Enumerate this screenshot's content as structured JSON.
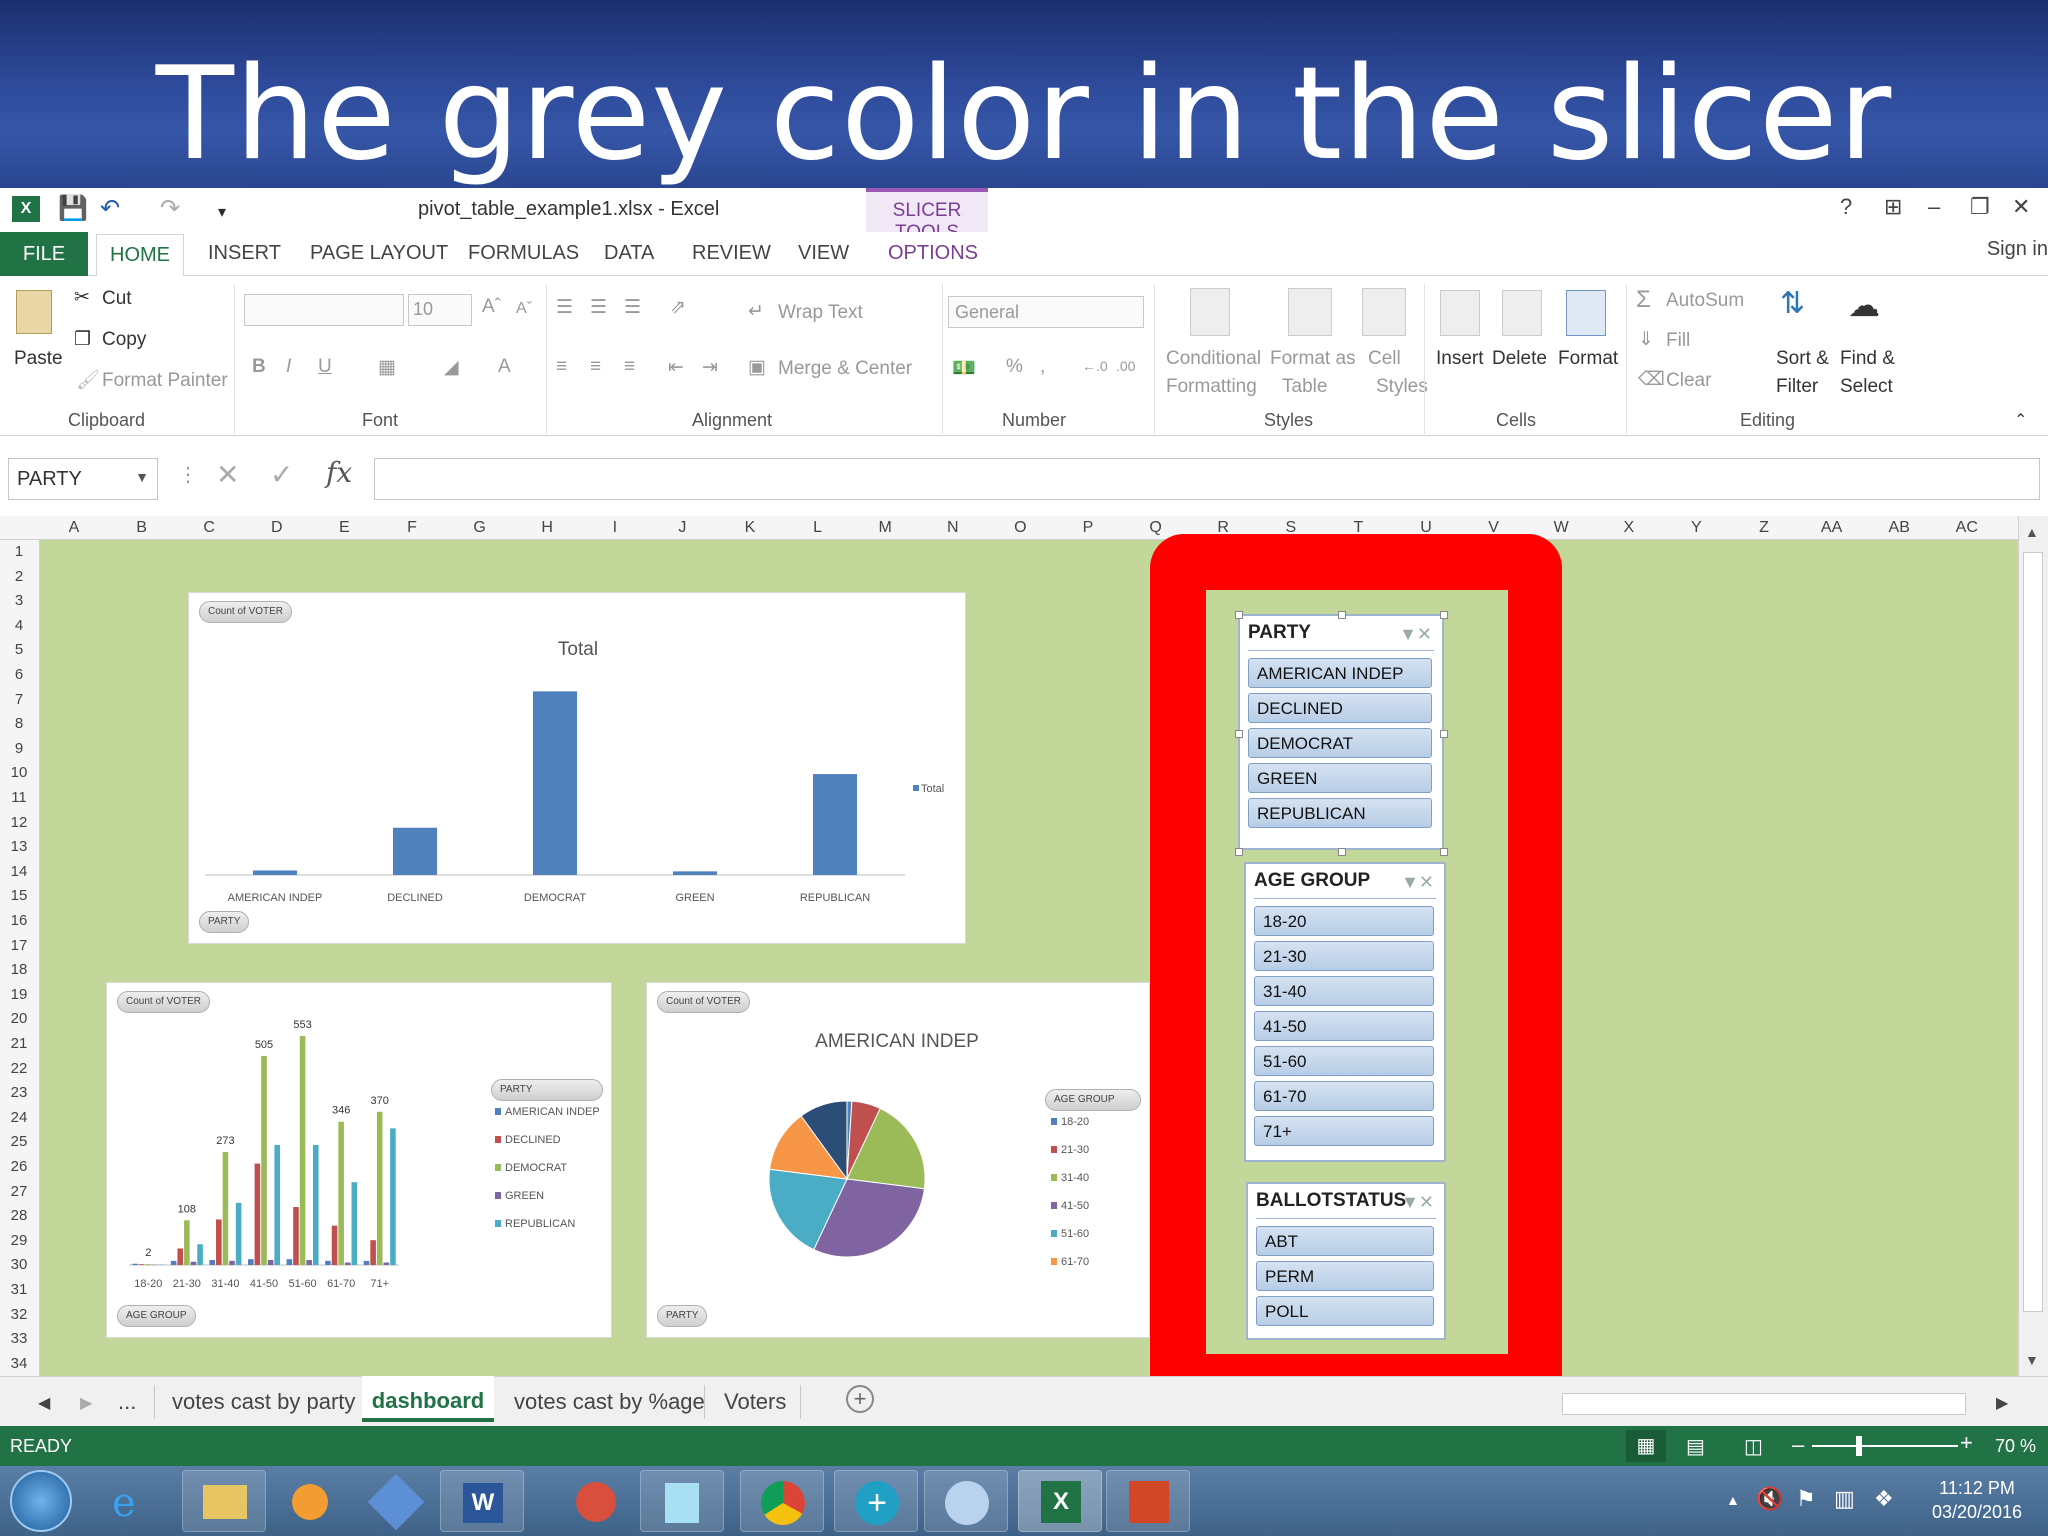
{
  "banner": {
    "title": "The grey color in the slicer"
  },
  "window": {
    "doc_title": "pivot_table_example1.xlsx - Excel",
    "contextual_tab_group": "SLICER TOOLS",
    "help": "?",
    "sign_in": "Sign in"
  },
  "ribbon_tabs": [
    "FILE",
    "HOME",
    "INSERT",
    "PAGE LAYOUT",
    "FORMULAS",
    "DATA",
    "REVIEW",
    "VIEW",
    "OPTIONS"
  ],
  "ribbon": {
    "clipboard": {
      "paste": "Paste",
      "cut": "Cut",
      "copy": "Copy",
      "format_painter": "Format Painter",
      "label": "Clipboard"
    },
    "font": {
      "size": "10",
      "bold": "B",
      "italic": "I",
      "underline": "U",
      "label": "Font"
    },
    "alignment": {
      "wrap_text": "Wrap Text",
      "merge_center": "Merge & Center",
      "label": "Alignment"
    },
    "number": {
      "format": "General",
      "label": "Number"
    },
    "styles": {
      "conditional_1": "Conditional",
      "conditional_2": "Formatting",
      "format_table_1": "Format as",
      "format_table_2": "Table",
      "cell_styles_1": "Cell",
      "cell_styles_2": "Styles",
      "label": "Styles"
    },
    "cells": {
      "insert": "Insert",
      "delete": "Delete",
      "format": "Format",
      "label": "Cells"
    },
    "editing": {
      "autosum": "AutoSum",
      "fill": "Fill",
      "clear": "Clear",
      "sort_1": "Sort &",
      "sort_2": "Filter",
      "find_1": "Find &",
      "find_2": "Select",
      "label": "Editing"
    }
  },
  "name_box": "PARTY",
  "columns": [
    "A",
    "B",
    "C",
    "D",
    "E",
    "F",
    "G",
    "H",
    "I",
    "J",
    "K",
    "L",
    "M",
    "N",
    "O",
    "P",
    "Q",
    "R",
    "S",
    "T",
    "U",
    "V",
    "W",
    "X",
    "Y",
    "Z",
    "AA",
    "AB",
    "AC"
  ],
  "rows": [
    "1",
    "2",
    "3",
    "4",
    "5",
    "6",
    "7",
    "8",
    "9",
    "10",
    "11",
    "12",
    "13",
    "14",
    "15",
    "16",
    "17",
    "18",
    "19",
    "20",
    "21",
    "22",
    "23",
    "24",
    "25",
    "26",
    "27",
    "28",
    "29",
    "30",
    "31",
    "32",
    "33",
    "34"
  ],
  "charts": {
    "top": {
      "pill": "Count of VOTER",
      "filter_pill": "PARTY",
      "legend": "Total"
    },
    "bottom_left": {
      "pill": "Count of VOTER",
      "filter_pill": "AGE GROUP",
      "legend_pill": "PARTY"
    },
    "pie": {
      "pill": "Count of VOTER",
      "filter_pill": "PARTY",
      "legend_pill": "AGE GROUP"
    }
  },
  "chart_data": [
    {
      "type": "bar",
      "title": "Total",
      "categories": [
        "AMERICAN INDEP",
        "DECLINED",
        "DEMOCRAT",
        "GREEN",
        "REPUBLICAN"
      ],
      "series": [
        {
          "name": "Total",
          "values": [
            25,
            260,
            1010,
            20,
            555
          ],
          "color": "#4f81bd"
        }
      ]
    },
    {
      "type": "bar",
      "categories": [
        "18-20",
        "21-30",
        "31-40",
        "41-50",
        "51-60",
        "61-70",
        "71+"
      ],
      "series": [
        {
          "name": "AMERICAN INDEP",
          "values": [
            3,
            10,
            12,
            14,
            14,
            10,
            10
          ],
          "color": "#4f81bd"
        },
        {
          "name": "DECLINED",
          "values": [
            2,
            40,
            110,
            245,
            140,
            95,
            60
          ],
          "color": "#c0504d"
        },
        {
          "name": "DEMOCRAT",
          "values": [
            2,
            108,
            273,
            505,
            553,
            346,
            370
          ],
          "color": "#9bbb59"
        },
        {
          "name": "GREEN",
          "values": [
            1,
            8,
            10,
            12,
            12,
            6,
            6
          ],
          "color": "#8064a2"
        },
        {
          "name": "REPUBLICAN",
          "values": [
            1,
            50,
            150,
            290,
            290,
            200,
            330
          ],
          "color": "#4bacc6"
        }
      ],
      "data_labels": [
        "2",
        "108",
        "273",
        "505",
        "553",
        "346",
        "370"
      ]
    },
    {
      "type": "pie",
      "title": "AMERICAN INDEP",
      "categories": [
        "18-20",
        "21-30",
        "31-40",
        "41-50",
        "51-60",
        "61-70",
        "71+"
      ],
      "values": [
        1,
        6,
        20,
        30,
        20,
        13,
        10
      ],
      "colors": [
        "#4f81bd",
        "#c0504d",
        "#9bbb59",
        "#8064a2",
        "#4bacc6",
        "#f79646",
        "#2c4d75"
      ],
      "legend": [
        "18-20",
        "21-30",
        "31-40",
        "41-50",
        "51-60",
        "61-70"
      ]
    }
  ],
  "slicers": [
    {
      "title": "PARTY",
      "items": [
        "AMERICAN INDEP",
        "DECLINED",
        "DEMOCRAT",
        "GREEN",
        "REPUBLICAN"
      ]
    },
    {
      "title": "AGE GROUP",
      "items": [
        "18-20",
        "21-30",
        "31-40",
        "41-50",
        "51-60",
        "61-70",
        "71+"
      ]
    },
    {
      "title": "BALLOTSTATUS",
      "items": [
        "ABT",
        "PERM",
        "POLL"
      ]
    }
  ],
  "sheet_tabs": {
    "ellipsis": "...",
    "tabs": [
      "votes cast by party",
      "dashboard",
      "votes cast by %age",
      "Voters"
    ],
    "active": "dashboard"
  },
  "status": {
    "ready": "READY",
    "zoom": "70 %"
  },
  "taskbar": {
    "time": "11:12 PM",
    "date": "03/20/2016"
  }
}
